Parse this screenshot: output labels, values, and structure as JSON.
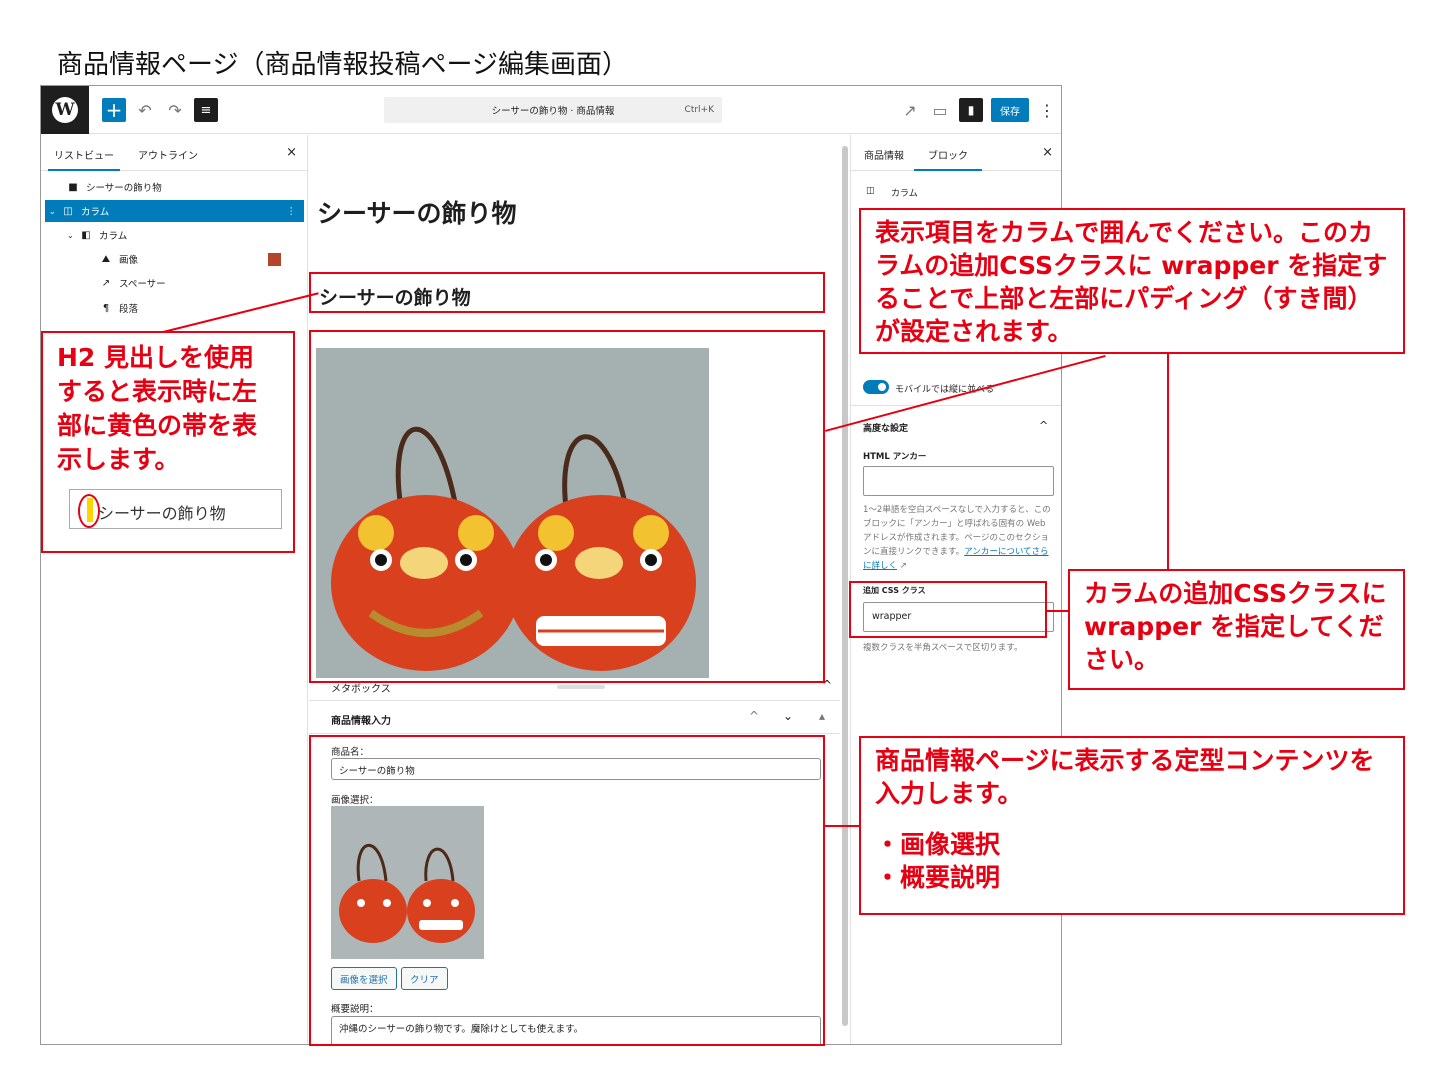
{
  "page_title": "商品情報ページ（商品情報投稿ページ編集画面）",
  "topbar": {
    "logo": "W",
    "add_icon": "+",
    "undo_icon": "↶",
    "redo_icon": "↷",
    "list_view_icon": "≡",
    "command_title": "シーサーの飾り物 · 商品情報",
    "command_shortcut": "Ctrl+K",
    "view_icon": "↗",
    "device_icon": "▭",
    "settings_icon": "▮",
    "save_label": "保存",
    "more_icon": "⋮"
  },
  "left_panel": {
    "tabs": [
      "リストビュー",
      "アウトライン"
    ],
    "close_icon": "×",
    "items": [
      {
        "label": "シーサーの飾り物",
        "icon": "bookmark-icon",
        "glyph": "■"
      },
      {
        "label": "カラム",
        "icon": "columns-icon",
        "glyph": "◫"
      },
      {
        "label": "カラム",
        "icon": "column-icon",
        "glyph": "◧"
      },
      {
        "label": "画像",
        "icon": "image-icon",
        "glyph": "⛰"
      },
      {
        "label": "スペーサー",
        "icon": "spacer-icon",
        "glyph": "↗"
      },
      {
        "label": "段落",
        "icon": "paragraph-icon",
        "glyph": "¶"
      }
    ],
    "more_icon": "⋮",
    "expand_icon": "⌄"
  },
  "canvas": {
    "post_title": "シーサーの飾り物",
    "h2": "シーサーの飾り物",
    "metabox_title": "メタボックス",
    "metabox_collapse_icon": "^",
    "meta_section_title": "商品情報入力",
    "meta_controls": [
      "^",
      "⌄",
      "▴"
    ],
    "product_name_label": "商品名：",
    "product_name_value": "シーサーの飾り物",
    "image_label": "画像選択：",
    "select_image_button": "画像を選択",
    "clear_button": "クリア",
    "summary_label": "概要説明：",
    "summary_value": "沖縄のシーサーの飾り物です。魔除けとしても使えます。"
  },
  "right_panel": {
    "tabs": [
      "商品情報",
      "ブロック"
    ],
    "close_icon": "×",
    "block_name": "カラム",
    "mobile_toggle_label": "モバイルでは縦に並べる",
    "advanced_label": "高度な設定",
    "advanced_icon": "^",
    "html_anchor_label": "HTML アンカー",
    "help_text": "1〜2単語を空白スペースなしで入力すると、このブロックに「アンカー」と呼ばれる固有の Web アドレスが作成されます。ページのこのセクションに直接リンクできます。",
    "help_link": "アンカーについてさらに詳しく",
    "css_class_label": "追加 CSS クラス",
    "css_class_value": "wrapper",
    "css_class_help": "複数クラスを半角スペースで区切ります。"
  },
  "annotations": {
    "h2_note": "H2 見出しを使用すると表示時に左部に黄色の帯を表示します。",
    "h2_demo": "シーサーの飾り物",
    "column_note": "表示項目をカラムで囲んでください。このカラムの追加CSSクラスに wrapper を指定することで上部と左部にパディング（すき間）が設定されます。",
    "css_note": "カラムの追加CSSクラスに wrapper を指定してください。",
    "content_note_lead": "商品情報ページに表示する定型コンテンツを入力します。",
    "content_note_items": [
      "・画像選択",
      "・概要説明"
    ]
  },
  "colors": {
    "accent": "#007cba",
    "annotation": "#e60012",
    "highlight": "#ffd400"
  }
}
